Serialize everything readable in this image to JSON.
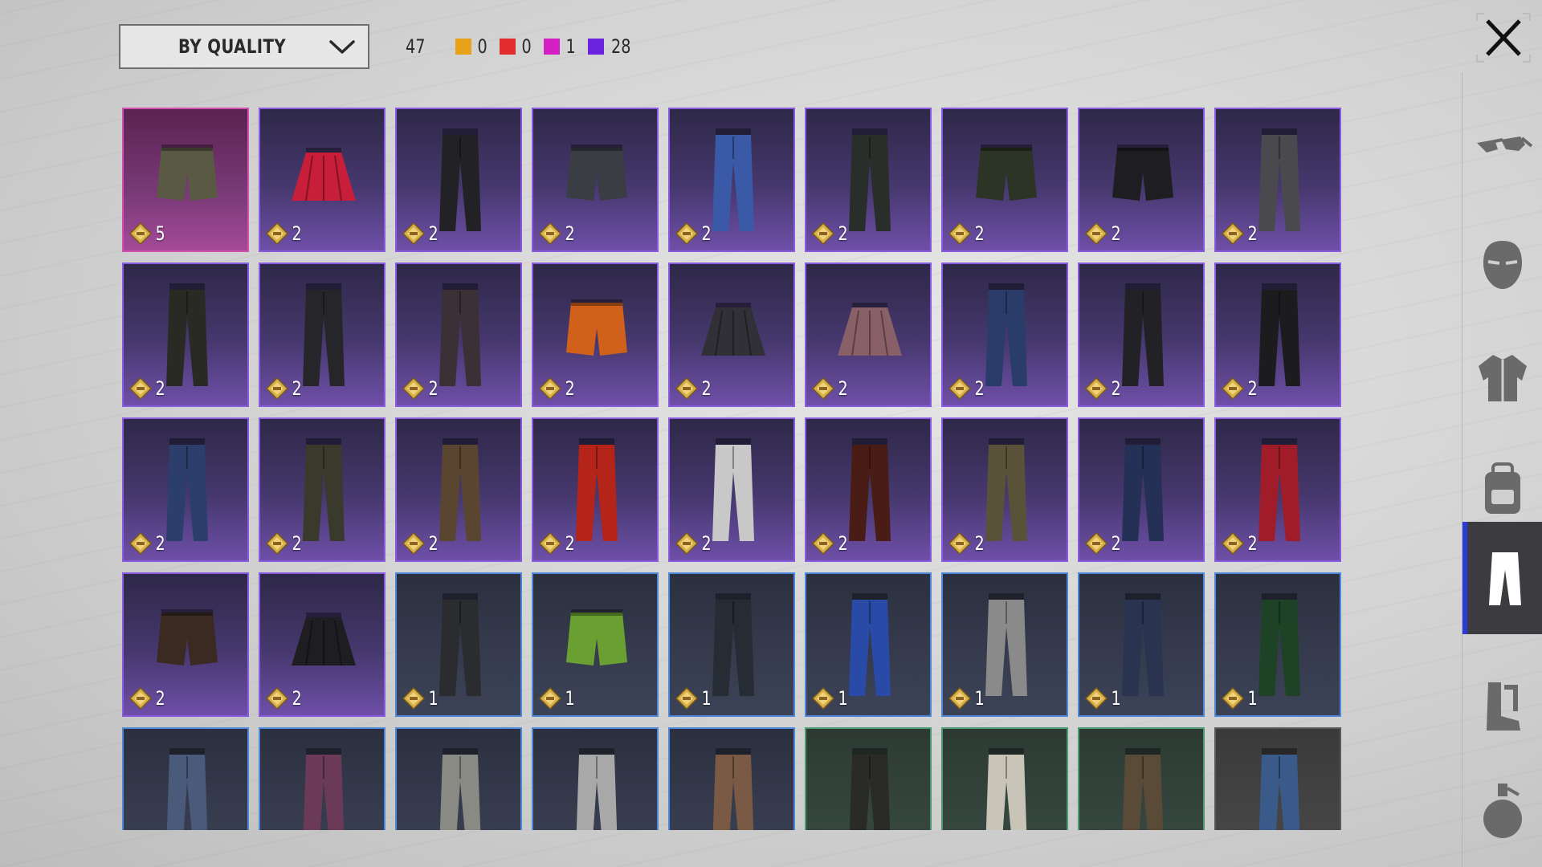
{
  "header": {
    "sort_select": {
      "label": "BY QUALITY"
    },
    "total_count": "47",
    "quality_counts": [
      {
        "color": "#e8a21a",
        "count": "0"
      },
      {
        "color": "#e02c2c",
        "count": "0"
      },
      {
        "color": "#d41fc4",
        "count": "1"
      },
      {
        "color": "#6a22e0",
        "count": "28"
      }
    ]
  },
  "close_icon": "close-icon",
  "sidebar": {
    "categories": [
      {
        "name": "glasses",
        "icon": "glasses-icon",
        "active": false
      },
      {
        "name": "mask",
        "icon": "mask-icon",
        "active": false
      },
      {
        "name": "top",
        "icon": "jacket-icon",
        "active": false
      },
      {
        "name": "backpack",
        "icon": "backpack-icon",
        "active": false
      },
      {
        "name": "pants",
        "icon": "pants-icon",
        "active": true
      },
      {
        "name": "shoes",
        "icon": "boots-icon",
        "active": false
      },
      {
        "name": "emote",
        "icon": "grenade-icon",
        "active": false
      }
    ]
  },
  "items": [
    {
      "quality": "pink",
      "value": "5",
      "kind": "shorts",
      "color": "#5a5a44"
    },
    {
      "quality": "purple",
      "value": "2",
      "kind": "skirt",
      "color": "#c81e3a"
    },
    {
      "quality": "purple",
      "value": "2",
      "kind": "pants",
      "color": "#222226"
    },
    {
      "quality": "purple",
      "value": "2",
      "kind": "shorts",
      "color": "#3a3e44"
    },
    {
      "quality": "purple",
      "value": "2",
      "kind": "pants",
      "color": "#3a5aa8"
    },
    {
      "quality": "purple",
      "value": "2",
      "kind": "pants",
      "color": "#2a2e2a"
    },
    {
      "quality": "purple",
      "value": "2",
      "kind": "shorts",
      "color": "#2c3426"
    },
    {
      "quality": "purple",
      "value": "2",
      "kind": "shorts",
      "color": "#1e1e22"
    },
    {
      "quality": "purple",
      "value": "2",
      "kind": "pants",
      "color": "#4a4a4e"
    },
    {
      "quality": "purple",
      "value": "2",
      "kind": "pants",
      "color": "#2a2a24"
    },
    {
      "quality": "purple",
      "value": "2",
      "kind": "pants",
      "color": "#26262a"
    },
    {
      "quality": "purple",
      "value": "2",
      "kind": "pants",
      "color": "#3a3036"
    },
    {
      "quality": "purple",
      "value": "2",
      "kind": "shorts",
      "color": "#d0601a"
    },
    {
      "quality": "purple",
      "value": "2",
      "kind": "skirt",
      "color": "#303036"
    },
    {
      "quality": "purple",
      "value": "2",
      "kind": "skirt",
      "color": "#8a6068"
    },
    {
      "quality": "purple",
      "value": "2",
      "kind": "pants",
      "color": "#2a3c6a"
    },
    {
      "quality": "purple",
      "value": "2",
      "kind": "pants",
      "color": "#222226"
    },
    {
      "quality": "purple",
      "value": "2",
      "kind": "pants",
      "color": "#1c1c1e"
    },
    {
      "quality": "purple",
      "value": "2",
      "kind": "pants",
      "color": "#2c3e6c"
    },
    {
      "quality": "purple",
      "value": "2",
      "kind": "pants",
      "color": "#3a3a2c"
    },
    {
      "quality": "purple",
      "value": "2",
      "kind": "pants",
      "color": "#5a4630"
    },
    {
      "quality": "purple",
      "value": "2",
      "kind": "pants",
      "color": "#b42418"
    },
    {
      "quality": "purple",
      "value": "2",
      "kind": "pants",
      "color": "#c8c8c8"
    },
    {
      "quality": "purple",
      "value": "2",
      "kind": "pants",
      "color": "#4a1c16"
    },
    {
      "quality": "purple",
      "value": "2",
      "kind": "pants",
      "color": "#5a5238"
    },
    {
      "quality": "purple",
      "value": "2",
      "kind": "pants",
      "color": "#243056"
    },
    {
      "quality": "purple",
      "value": "2",
      "kind": "pants",
      "color": "#a01c28"
    },
    {
      "quality": "purple",
      "value": "2",
      "kind": "shorts",
      "color": "#3a2a22"
    },
    {
      "quality": "purple",
      "value": "2",
      "kind": "skirt",
      "color": "#1e1e22"
    },
    {
      "quality": "blue",
      "value": "1",
      "kind": "pants",
      "color": "#2a2c30"
    },
    {
      "quality": "blue",
      "value": "1",
      "kind": "shorts",
      "color": "#6aa032"
    },
    {
      "quality": "blue",
      "value": "1",
      "kind": "pants",
      "color": "#262c34"
    },
    {
      "quality": "blue",
      "value": "1",
      "kind": "pants",
      "color": "#2a4aa8"
    },
    {
      "quality": "blue",
      "value": "1",
      "kind": "pants",
      "color": "#8a8a8a"
    },
    {
      "quality": "blue",
      "value": "1",
      "kind": "pants",
      "color": "#2a3450"
    },
    {
      "quality": "blue",
      "value": "1",
      "kind": "pants",
      "color": "#1e4226"
    },
    {
      "quality": "blue",
      "value": "",
      "kind": "pants",
      "color": "#4a5a7a"
    },
    {
      "quality": "blue",
      "value": "",
      "kind": "pants",
      "color": "#6a3a58"
    },
    {
      "quality": "blue",
      "value": "",
      "kind": "pants",
      "color": "#8a8a84"
    },
    {
      "quality": "blue",
      "value": "",
      "kind": "pants",
      "color": "#a8a8a8"
    },
    {
      "quality": "blue",
      "value": "",
      "kind": "pants",
      "color": "#7a5a44"
    },
    {
      "quality": "green",
      "value": "",
      "kind": "pants",
      "color": "#2a2a26"
    },
    {
      "quality": "green",
      "value": "",
      "kind": "pants",
      "color": "#c8c4b8"
    },
    {
      "quality": "green",
      "value": "",
      "kind": "pants",
      "color": "#5a4a38"
    },
    {
      "quality": "gray",
      "value": "",
      "kind": "pants",
      "color": "#3a5a8a"
    }
  ]
}
